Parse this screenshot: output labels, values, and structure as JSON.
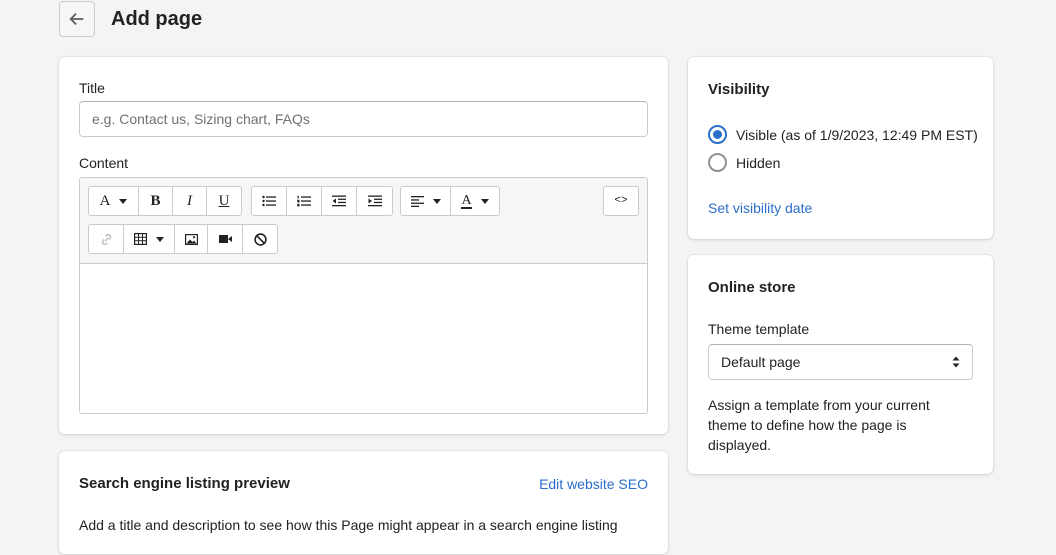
{
  "header": {
    "title": "Add page",
    "back_icon": "arrow-left-icon"
  },
  "main": {
    "title_label": "Title",
    "title_placeholder": "e.g. Contact us, Sizing chart, FAQs",
    "title_value": "",
    "content_label": "Content",
    "toolbar": {
      "font_glyph": "A",
      "bold_glyph": "B",
      "italic_glyph": "I",
      "underline_glyph": "U",
      "text_color_glyph": "A",
      "code_glyph": "<>"
    }
  },
  "seo": {
    "title": "Search engine listing preview",
    "edit_link": "Edit website SEO",
    "description": "Add a title and description to see how this Page might appear in a search engine listing"
  },
  "visibility": {
    "title": "Visibility",
    "options": [
      {
        "label": "Visible (as of 1/9/2023, 12:49 PM EST)",
        "checked": true
      },
      {
        "label": "Hidden",
        "checked": false
      }
    ],
    "set_date_link": "Set visibility date"
  },
  "online_store": {
    "title": "Online store",
    "template_label": "Theme template",
    "template_value": "Default page",
    "help_text": "Assign a template from your current theme to define how the page is displayed."
  },
  "colors": {
    "link": "#2c6ecb",
    "radio_checked": "#2c6ecb",
    "background": "#f4f4f4"
  }
}
